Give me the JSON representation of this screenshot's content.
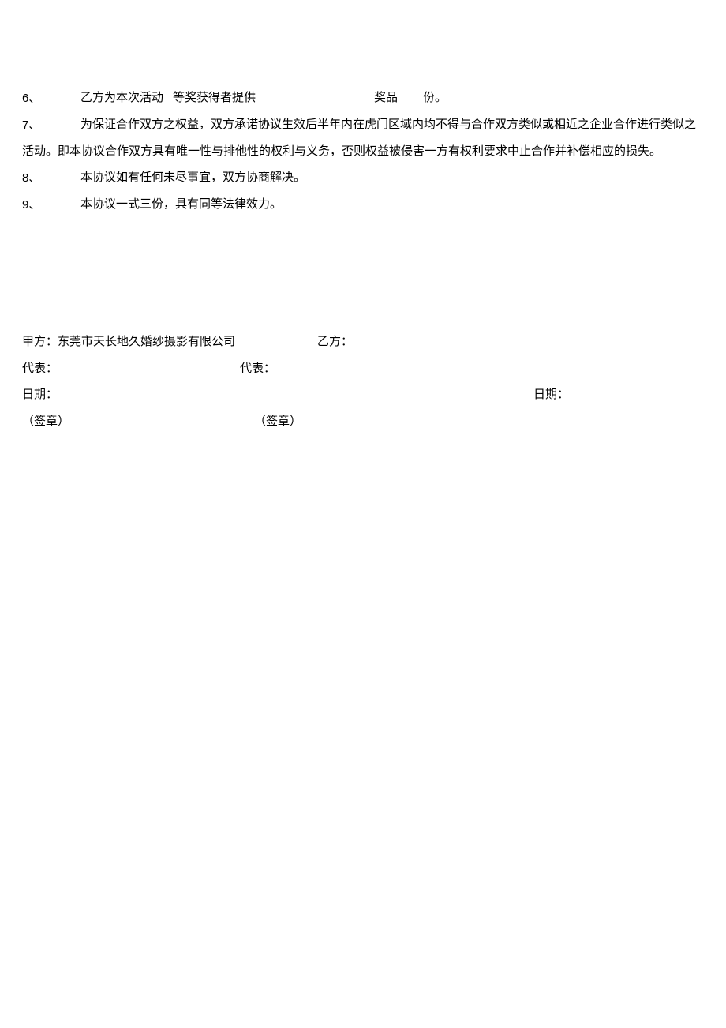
{
  "clauses": {
    "c6": {
      "num": "6、",
      "p1": "乙方为本次活动",
      "p2": "等奖获得者提供",
      "p3": "奖品",
      "p4": "份。"
    },
    "c7": {
      "num": "7、",
      "text": "为保证合作双方之权益，双方承诺协议生效后半年内在虎门区域内均不得与合作双方类似或相近之企业合作进行类似之活动。即本协议合作双方具有唯一性与排他性的权利与义务，否则权益被侵害一方有权利要求中止合作并补偿相应的损失。"
    },
    "c8": {
      "num": "8、",
      "text": "本协议如有任何未尽事宜，双方协商解决。"
    },
    "c9": {
      "num": "9、",
      "text": "本协议一式三份，具有同等法律效力。"
    }
  },
  "sig": {
    "party_a_label": "甲方：",
    "party_a_name": "东莞市天长地久婚纱摄影有限公司",
    "party_b_label": "乙方：",
    "rep_label": "代表：",
    "date_label": "日期：",
    "seal_label": "（签章）"
  }
}
